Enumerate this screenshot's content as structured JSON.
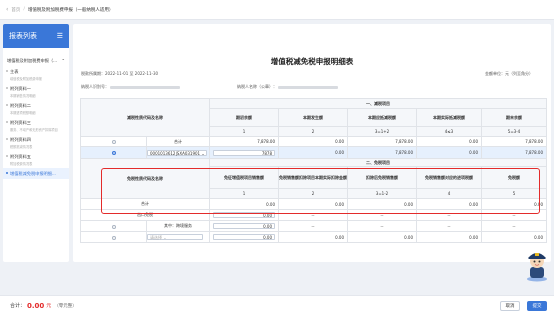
{
  "breadcrumb": [
    "首页",
    "增值税及附加税费申报（一般纳税人适用）"
  ],
  "sidebar": {
    "title": "报表列表",
    "group": "增值税及附加税费申报（...",
    "items": [
      {
        "label": "主表",
        "sub": "增值税及附加税费申报"
      },
      {
        "label": "附列资料一",
        "sub": "本期销售情况明细"
      },
      {
        "label": "附列资料二",
        "sub": "本期进项税额明细"
      },
      {
        "label": "附列资料三",
        "sub": "服务、不动产和无形资产扣除项目"
      },
      {
        "label": "附列资料四",
        "sub": "税额抵减情况表"
      },
      {
        "label": "附列资料五",
        "sub": "附加税费情况表"
      },
      {
        "label": "增值税减免税申报明细..."
      }
    ]
  },
  "report": {
    "title": "增值税减免税申报明细表",
    "period_label": "税款所属期：",
    "period_value": "2022-11-01 至 2022-11-30",
    "unit_label": "金额单位：",
    "unit_value": "元（列至角分）",
    "taxpayer_id_label": "纳税人识别号：",
    "taxpayer_name_label": "纳税人名称（公章）："
  },
  "section1": {
    "title": "一、减税项目",
    "rowhead": "减税性质代码及名称",
    "cols": [
      "期初余额",
      "本期发生额",
      "本期应抵减税额",
      "本期实际抵减税额",
      "期末余额"
    ],
    "nums": [
      "1",
      "2",
      "3=1+2",
      "4≤3",
      "5=3-4"
    ],
    "total": {
      "label": "合计",
      "values": [
        "7,878.00",
        "0.00",
        "7,878.00",
        "0.00",
        "7,878.00"
      ]
    },
    "row": {
      "select": "0001013612|SXA031901",
      "input1": "7878",
      "values": [
        "0.00",
        "7,878.00",
        "0.00",
        "7,878.00"
      ]
    }
  },
  "section2": {
    "title": "二、免税项目",
    "rowhead": "免税性质代码及名称",
    "cols": [
      "免征增值税项目销售额",
      "免税销售额扣除项目本期实际扣除金额",
      "扣除后免税销售额",
      "免税销售额对应的进项税额",
      "免税额"
    ],
    "nums": [
      "1",
      "2",
      "3=1-2",
      "4",
      "5"
    ],
    "rows": [
      {
        "label": "合计",
        "values": [
          "0.00",
          "0.00",
          "0.00",
          "0.00",
          "0.00"
        ]
      },
      {
        "label": "出口免税",
        "input": "0.00",
        "values": [
          "--",
          "--",
          "--",
          "--"
        ]
      },
      {
        "label": "其中：跨境服务",
        "input": "0.00",
        "values": [
          "--",
          "--",
          "--",
          "--"
        ]
      },
      {
        "select": "请选择",
        "input": "0.00",
        "values": [
          "0.00",
          "0.00",
          "0.00",
          "0.00"
        ]
      }
    ]
  },
  "footer": {
    "total_label": "合计：",
    "amount": "0.00",
    "unit": "元",
    "cny_text": "（零元整）",
    "cancel": "取消",
    "submit": "提交"
  },
  "colors": {
    "accent": "#3a77d8",
    "highlight": "#e32b2b"
  }
}
